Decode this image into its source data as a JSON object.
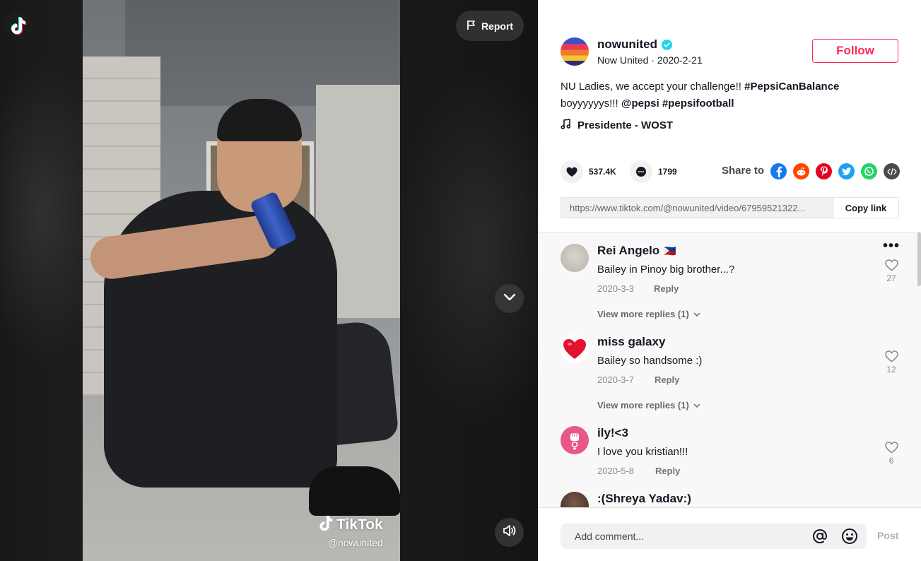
{
  "video": {
    "report_label": "Report",
    "watermark_brand": "TikTok",
    "watermark_handle": "@nowunited"
  },
  "author": {
    "username": "nowunited",
    "display_name": "Now United",
    "separator": " · ",
    "date": "2020-2-21",
    "follow_label": "Follow"
  },
  "caption": {
    "text_1": "NU Ladies, we accept your challenge!! ",
    "tag_1": "#PepsiCanBalance",
    "text_2": "boyyyyyys!!! ",
    "tag_2": "@pepsi",
    "tag_3": "#pepsifootball"
  },
  "music": {
    "title": "Presidente - WOST"
  },
  "stats": {
    "likes": "537.4K",
    "comments": "1799"
  },
  "share": {
    "label": "Share to",
    "icons": [
      "facebook-icon",
      "reddit-icon",
      "pinterest-icon",
      "twitter-icon",
      "whatsapp-icon",
      "embed-icon"
    ],
    "colors": {
      "facebook": "#1877F2",
      "reddit": "#FF4500",
      "pinterest": "#E60023",
      "twitter": "#1DA1F2",
      "whatsapp": "#25D366",
      "embed": "#4a4a4a"
    }
  },
  "link": {
    "url": "https://www.tiktok.com/@nowunited/video/67959521322...",
    "copy_label": "Copy link"
  },
  "comments": [
    {
      "name": "Rei Angelo",
      "flag": "🇵🇭",
      "text": "Bailey in Pinoy big brother...?",
      "date": "2020-3-3",
      "reply_label": "Reply",
      "likes": "27",
      "more_replies": "View more replies (1)"
    },
    {
      "name": "miss galaxy",
      "text": "Bailey so handsome :)",
      "date": "2020-3-7",
      "reply_label": "Reply",
      "likes": "12",
      "more_replies": "View more replies (1)"
    },
    {
      "name": "ily!<3",
      "text": "I love you kristian!!!",
      "date": "2020-5-8",
      "reply_label": "Reply",
      "likes": "6"
    },
    {
      "name": ":(Shreya Yadav:)"
    }
  ],
  "comment_bar": {
    "placeholder": "Add comment...",
    "post_label": "Post"
  },
  "theme": {
    "accent": "#FE2C55",
    "verified": "#20D5EC"
  }
}
